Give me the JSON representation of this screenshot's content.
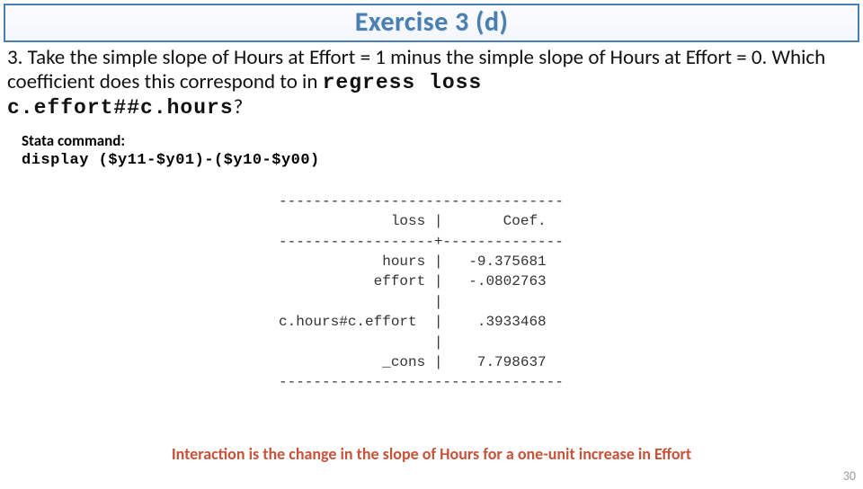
{
  "title": "Exercise 3 (d)",
  "question": {
    "part1": "3. Take the simple slope of Hours at Effort = 1 minus the simple slope of Hours at Effort = 0. Which coefficient does this correspond to in ",
    "code1": "regress loss",
    "code2": "c.effort##c.hours",
    "tail": "?"
  },
  "command": {
    "label": "Stata command:",
    "code": "display ($y11-$y01)-($y10-$y00)"
  },
  "table": {
    "dash_top": "---------------------------------",
    "header": "             loss |       Coef.  ",
    "dash_mid": "------------------+--------------",
    "r1": "            hours |   -9.375681  ",
    "r2": "           effort |   -.0802763  ",
    "blank1": "                  |              ",
    "r3": "c.hours#c.effort  |    .3933468  ",
    "blank2": "                  |              ",
    "r4": "            _cons |    7.798637  ",
    "dash_bot": "---------------------------------"
  },
  "caption": "Interaction is the change in the slope of Hours for a one-unit increase in Effort",
  "pagenum": "30",
  "chart_data": {
    "type": "table",
    "title": "Regression coefficients (regress loss c.effort##c.hours)",
    "columns": [
      "loss",
      "Coef."
    ],
    "rows": [
      {
        "loss": "hours",
        "Coef.": -9.375681
      },
      {
        "loss": "effort",
        "Coef.": -0.0802763
      },
      {
        "loss": "c.hours#c.effort",
        "Coef.": 0.3933468
      },
      {
        "loss": "_cons",
        "Coef.": 7.798637
      }
    ]
  }
}
